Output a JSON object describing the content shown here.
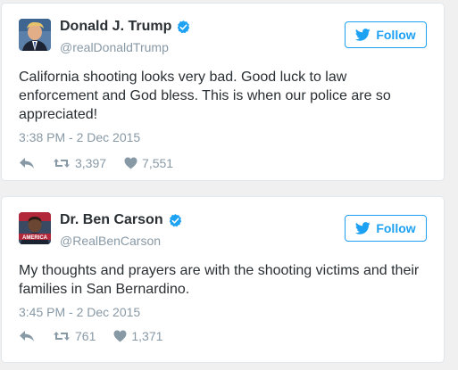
{
  "colors": {
    "brand_blue": "#1da1f2",
    "verified_blue": "#1da1f2",
    "muted_gray": "#8899a6",
    "text": "#292f33"
  },
  "tweets": [
    {
      "display_name": "Donald J. Trump",
      "handle": "@realDonaldTrump",
      "follow_label": "Follow",
      "text": "California shooting looks very bad. Good luck to law enforcement and God bless. This is when our police are so appreciated!",
      "timestamp": "3:38 PM - 2 Dec 2015",
      "retweets": "3,397",
      "likes": "7,551",
      "icons": [
        "verified-icon",
        "twitter-bird-icon",
        "reply-icon",
        "retweet-icon",
        "heart-icon"
      ]
    },
    {
      "display_name": "Dr. Ben Carson",
      "handle": "@RealBenCarson",
      "follow_label": "Follow",
      "text": "My thoughts and prayers are with the shooting victims and their families in San Bernardino.",
      "timestamp": "3:45 PM - 2 Dec 2015",
      "retweets": "761",
      "likes": "1,371",
      "avatar_caption": "AMERICA",
      "icons": [
        "verified-icon",
        "twitter-bird-icon",
        "reply-icon",
        "retweet-icon",
        "heart-icon"
      ]
    }
  ]
}
